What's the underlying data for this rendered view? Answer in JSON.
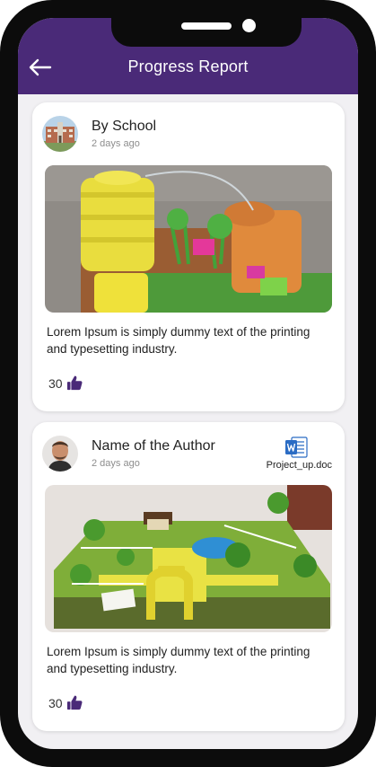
{
  "header": {
    "title": "Progress Report",
    "background": "#4a2a78",
    "back_icon": "arrow-left-icon"
  },
  "posts": [
    {
      "author": "By School",
      "time": "2 days ago",
      "avatar": "school-building-photo",
      "image": "water-tank-garden-model-photo",
      "text": "Lorem Ipsum is simply dummy text of the printing and typesetting industry.",
      "likes": "30",
      "like_icon": "thumbs-up-icon"
    },
    {
      "author": "Name of the Author",
      "time": "2 days ago",
      "avatar": "author-portrait-photo",
      "attachment": {
        "icon": "word-document-icon",
        "name": "Project_up.doc"
      },
      "image": "zoo-model-photo",
      "text": "Lorem Ipsum is simply dummy text of the printing and typesetting industry.",
      "likes": "30",
      "like_icon": "thumbs-up-icon"
    }
  ]
}
